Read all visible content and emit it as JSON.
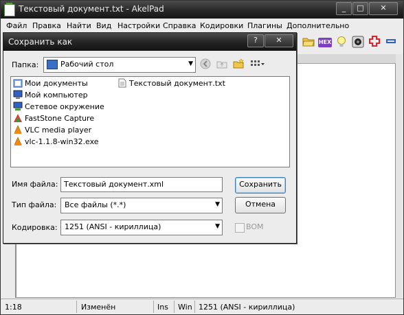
{
  "window": {
    "title": "Текстовый документ.txt - AkelPad",
    "controls": {
      "minimize": "_",
      "maximize": "□",
      "close": "✕"
    }
  },
  "menubar": [
    "Файл",
    "Правка",
    "Найти",
    "Вид",
    "Настройки",
    "Справка",
    "Кодировки",
    "Плагины",
    "Дополнительно"
  ],
  "toolbar": {
    "icons": [
      "open-folder-icon",
      "hex-icon",
      "lightbulb-icon",
      "speaker-icon",
      "red-cross-icon",
      "blue-minus-icon"
    ],
    "hex_label": "HEX"
  },
  "dialog": {
    "title": "Сохранить как",
    "help": "?",
    "close": "✕",
    "folder_label": "Папка:",
    "folder_value": "Рабочий стол",
    "files": [
      {
        "name": "Мои документы",
        "icon": "my-documents-icon"
      },
      {
        "name": "Мой компьютер",
        "icon": "my-computer-icon"
      },
      {
        "name": "Сетевое окружение",
        "icon": "network-icon"
      },
      {
        "name": "FastStone Capture",
        "icon": "faststone-icon"
      },
      {
        "name": "VLC media player",
        "icon": "vlc-icon"
      },
      {
        "name": "vlc-1.1.8-win32.exe",
        "icon": "vlc-icon"
      },
      {
        "name": "Текстовый документ.txt",
        "icon": "text-file-icon"
      }
    ],
    "filename_label": "Имя файла:",
    "filename_value": "Текстовый документ.xml",
    "filetype_label": "Тип файла:",
    "filetype_value": "Все файлы (*.*)",
    "encoding_label": "Кодировка:",
    "encoding_value": "1251  (ANSI - кириллица)",
    "bom_label": "BOM",
    "bom_checked": false,
    "save_button": "Сохранить",
    "cancel_button": "Отмена"
  },
  "statusbar": {
    "position": "1:18",
    "modified": "Изменён",
    "insert": "Ins",
    "newline": "Win",
    "codepage": "1251  (ANSI - кириллица)"
  },
  "colors": {
    "titlebar": "#2a2a2a",
    "dialog_bg": "#ececec",
    "default_button_border": "#3c7fb1",
    "red_cross": "#e0202a",
    "blue_minus": "#2f5fcf"
  }
}
